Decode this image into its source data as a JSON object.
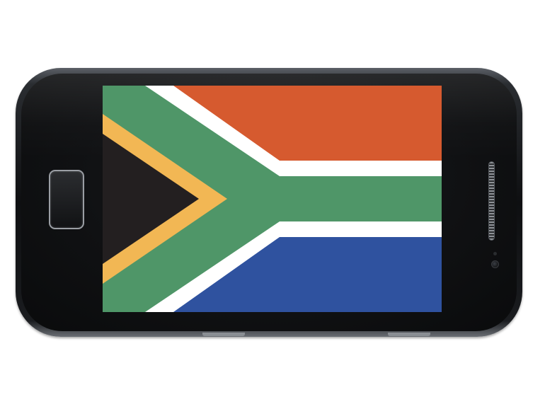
{
  "scene": {
    "subject": "smartphone",
    "orientation": "landscape"
  },
  "screen": {
    "content": "flag-of-south-africa",
    "colors": {
      "red": "#d65a2f",
      "white": "#ffffff",
      "green": "#4f9668",
      "black": "#231f20",
      "gold": "#f2b754",
      "blue": "#2f529f"
    }
  },
  "phone": {
    "body_color": "#111214",
    "bezel_color": "#5b5f66"
  }
}
